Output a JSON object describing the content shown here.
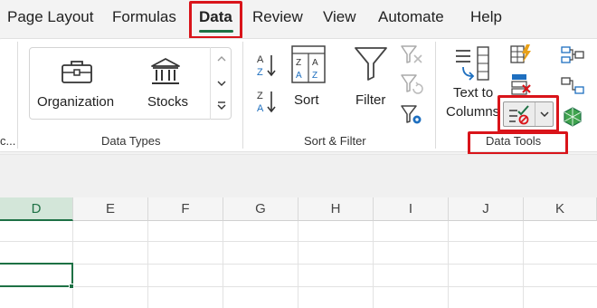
{
  "tabs": [
    {
      "label": "Page Layout"
    },
    {
      "label": "Formulas"
    },
    {
      "label": "Data",
      "active": true
    },
    {
      "label": "Review"
    },
    {
      "label": "View"
    },
    {
      "label": "Automate"
    },
    {
      "label": "Help"
    }
  ],
  "colors": {
    "accent": "#1e7145",
    "highlight": "#d9141a"
  },
  "ribbon": {
    "cut_off_group_label": "c...",
    "data_types": {
      "label": "Data Types",
      "items": [
        {
          "label": "Organization",
          "icon": "briefcase-icon"
        },
        {
          "label": "Stocks",
          "icon": "bank-icon"
        }
      ]
    },
    "sort_filter": {
      "label": "Sort & Filter",
      "sort_az_icon": "sort-a-to-z-icon",
      "sort_za_icon": "sort-z-to-a-icon",
      "sort": {
        "label": "Sort",
        "icon": "sort-dialog-icon"
      },
      "filter": {
        "label": "Filter",
        "icon": "funnel-icon"
      },
      "clear_icon": "clear-filter-icon",
      "reapply_icon": "reapply-filter-icon",
      "advanced_icon": "advanced-filter-icon"
    },
    "data_tools": {
      "label": "Data Tools",
      "text_to_columns": {
        "line1": "Text to",
        "line2": "Columns"
      },
      "flash_fill_icon": "flash-fill-icon",
      "remove_duplicates_icon": "remove-duplicates-icon",
      "data_validation_icon": "data-validation-icon",
      "consolidate_icon": "consolidate-icon",
      "relationships_icon": "relationships-icon"
    }
  },
  "grid": {
    "columns": [
      "D",
      "E",
      "F",
      "G",
      "H",
      "I",
      "J",
      "K"
    ],
    "selected_column": "D"
  }
}
